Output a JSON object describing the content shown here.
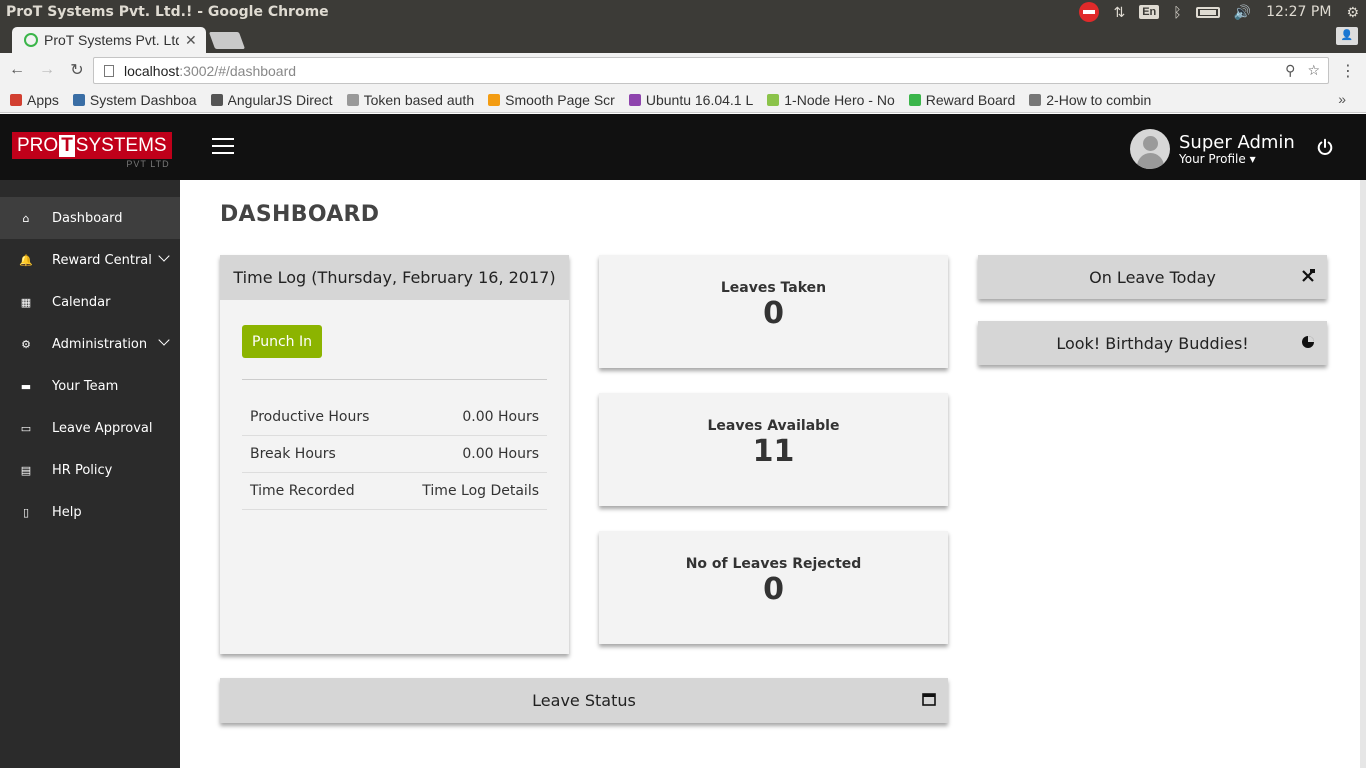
{
  "os": {
    "window_title": "ProT Systems Pvt. Ltd.! - Google Chrome",
    "keyboard": "En",
    "time": "12:27 PM"
  },
  "browser": {
    "tab_title": "ProT Systems Pvt. Ltd.!",
    "url_host": "localhost",
    "url_rest": ":3002/#/dashboard",
    "bookmarks": [
      {
        "label": "Apps",
        "color": "#d23f31"
      },
      {
        "label": "System Dashboa",
        "color": "#3a6ea5"
      },
      {
        "label": "AngularJS Direct",
        "color": "#555555"
      },
      {
        "label": "Token based auth",
        "color": "#999999"
      },
      {
        "label": "Smooth Page Scr",
        "color": "#f39c12"
      },
      {
        "label": "Ubuntu 16.04.1 L",
        "color": "#8e44ad"
      },
      {
        "label": "1-Node Hero - No",
        "color": "#8bc34a"
      },
      {
        "label": "Reward Board",
        "color": "#3bb54a"
      },
      {
        "label": "2-How to combin",
        "color": "#777777"
      }
    ]
  },
  "app": {
    "brand": {
      "pro": "PRO",
      "t": "T",
      "systems": "SYSTEMS",
      "sub": "PVT LTD"
    },
    "user": {
      "name": "Super Admin",
      "profile_label": "Your Profile"
    },
    "sidebar": [
      {
        "label": "Dashboard",
        "icon": "home-icon",
        "glyph": "⌂",
        "active": true,
        "expandable": false
      },
      {
        "label": "Reward Central",
        "icon": "bell-icon",
        "glyph": "🔔",
        "active": false,
        "expandable": true
      },
      {
        "label": "Calendar",
        "icon": "calendar-icon",
        "glyph": "▦",
        "active": false,
        "expandable": false
      },
      {
        "label": "Administration",
        "icon": "gear-icon",
        "glyph": "⚙",
        "active": false,
        "expandable": true
      },
      {
        "label": "Your Team",
        "icon": "briefcase-icon",
        "glyph": "▬",
        "active": false,
        "expandable": false
      },
      {
        "label": "Leave Approval",
        "icon": "laptop-icon",
        "glyph": "▭",
        "active": false,
        "expandable": false
      },
      {
        "label": "HR Policy",
        "icon": "document-icon",
        "glyph": "▤",
        "active": false,
        "expandable": false
      },
      {
        "label": "Help",
        "icon": "file-icon",
        "glyph": "▯",
        "active": false,
        "expandable": false
      }
    ],
    "page_title": "DASHBOARD",
    "timelog": {
      "title": "Time Log (Thursday, February 16, 2017)",
      "punch_label": "Punch In",
      "rows": [
        {
          "label": "Productive Hours",
          "value": "0.00 Hours"
        },
        {
          "label": "Break Hours",
          "value": "0.00 Hours"
        },
        {
          "label": "Time Recorded",
          "value": "Time Log Details"
        }
      ]
    },
    "stats": [
      {
        "label": "Leaves Taken",
        "value": "0"
      },
      {
        "label": "Leaves Available",
        "value": "11"
      },
      {
        "label": "No of Leaves Rejected",
        "value": "0"
      }
    ],
    "on_leave_title": "On Leave Today",
    "birthday_title": "Look! Birthday Buddies!",
    "leave_status_title": "Leave Status",
    "colors": {
      "accent_green": "#8cb400",
      "brand_red": "#c0001a",
      "sidebar_bg": "#2b2b2b"
    }
  }
}
